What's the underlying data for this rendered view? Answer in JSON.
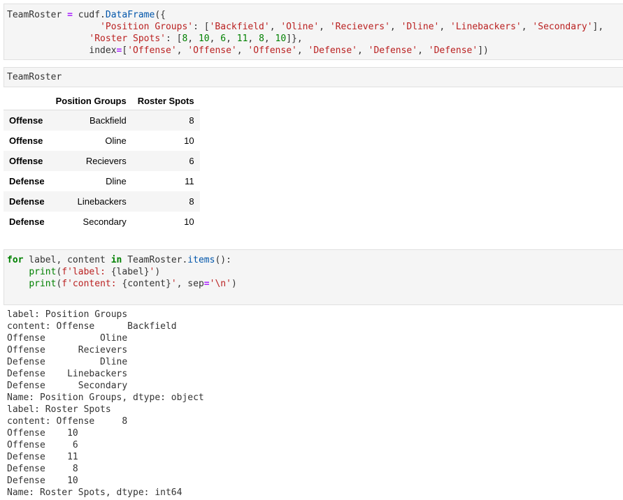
{
  "cell1": {
    "lines": [
      [
        [
          "TeamRoster ",
          ""
        ],
        [
          "=",
          "op"
        ],
        [
          " cudf.",
          ""
        ],
        [
          "DataFrame",
          "fn"
        ],
        [
          "({",
          ""
        ]
      ],
      [
        [
          "                 ",
          ""
        ],
        [
          "'Position Groups'",
          "st"
        ],
        [
          ": [",
          ""
        ],
        [
          "'Backfield'",
          "st"
        ],
        [
          ", ",
          ""
        ],
        [
          "'Oline'",
          "st"
        ],
        [
          ", ",
          ""
        ],
        [
          "'Recievers'",
          "st"
        ],
        [
          ", ",
          ""
        ],
        [
          "'Dline'",
          "st"
        ],
        [
          ", ",
          ""
        ],
        [
          "'Linebackers'",
          "st"
        ],
        [
          ", ",
          ""
        ],
        [
          "'Secondary'",
          "st"
        ],
        [
          "],",
          ""
        ]
      ],
      [
        [
          "               ",
          ""
        ],
        [
          "'Roster Spots'",
          "st"
        ],
        [
          ": [",
          ""
        ],
        [
          "8",
          "nu"
        ],
        [
          ", ",
          ""
        ],
        [
          "10",
          "nu"
        ],
        [
          ", ",
          ""
        ],
        [
          "6",
          "nu"
        ],
        [
          ", ",
          ""
        ],
        [
          "11",
          "nu"
        ],
        [
          ", ",
          ""
        ],
        [
          "8",
          "nu"
        ],
        [
          ", ",
          ""
        ],
        [
          "10",
          "nu"
        ],
        [
          "]},",
          ""
        ]
      ],
      [
        [
          "               index",
          ""
        ],
        [
          "=",
          "op"
        ],
        [
          "[",
          ""
        ],
        [
          "'Offense'",
          "st"
        ],
        [
          ", ",
          ""
        ],
        [
          "'Offense'",
          "st"
        ],
        [
          ", ",
          ""
        ],
        [
          "'Offense'",
          "st"
        ],
        [
          ", ",
          ""
        ],
        [
          "'Defense'",
          "st"
        ],
        [
          ", ",
          ""
        ],
        [
          "'Defense'",
          "st"
        ],
        [
          ", ",
          ""
        ],
        [
          "'Defense'",
          "st"
        ],
        [
          "])",
          ""
        ]
      ]
    ]
  },
  "cell2": {
    "code": "TeamRoster"
  },
  "table": {
    "columns": [
      "",
      "Position Groups",
      "Roster Spots"
    ],
    "rows": [
      [
        "Offense",
        "Backfield",
        "8"
      ],
      [
        "Offense",
        "Oline",
        "10"
      ],
      [
        "Offense",
        "Recievers",
        "6"
      ],
      [
        "Defense",
        "Dline",
        "11"
      ],
      [
        "Defense",
        "Linebackers",
        "8"
      ],
      [
        "Defense",
        "Secondary",
        "10"
      ]
    ]
  },
  "cell3": {
    "lines": [
      [
        [
          "for",
          "kw"
        ],
        [
          " label, content ",
          ""
        ],
        [
          "in",
          "kw"
        ],
        [
          " TeamRoster.",
          ""
        ],
        [
          "items",
          "fn"
        ],
        [
          "():",
          ""
        ]
      ],
      [
        [
          "    ",
          ""
        ],
        [
          "print",
          "bi"
        ],
        [
          "(",
          ""
        ],
        [
          "f'label: ",
          "st"
        ],
        [
          "{label}",
          ""
        ],
        [
          "'",
          "st"
        ],
        [
          ")",
          ""
        ]
      ],
      [
        [
          "    ",
          ""
        ],
        [
          "print",
          "bi"
        ],
        [
          "(",
          ""
        ],
        [
          "f'content: ",
          "st"
        ],
        [
          "{content}",
          ""
        ],
        [
          "'",
          "st"
        ],
        [
          ", sep",
          ""
        ],
        [
          "=",
          "op"
        ],
        [
          "'\\n'",
          "st"
        ],
        [
          ")",
          ""
        ]
      ]
    ]
  },
  "output": "label: Position Groups\ncontent: Offense      Backfield\nOffense          Oline\nOffense      Recievers\nDefense          Dline\nDefense    Linebackers\nDefense      Secondary\nName: Position Groups, dtype: object\nlabel: Roster Spots\ncontent: Offense     8\nOffense    10\nOffense     6\nDefense    11\nDefense     8\nDefense    10\nName: Roster Spots, dtype: int64"
}
